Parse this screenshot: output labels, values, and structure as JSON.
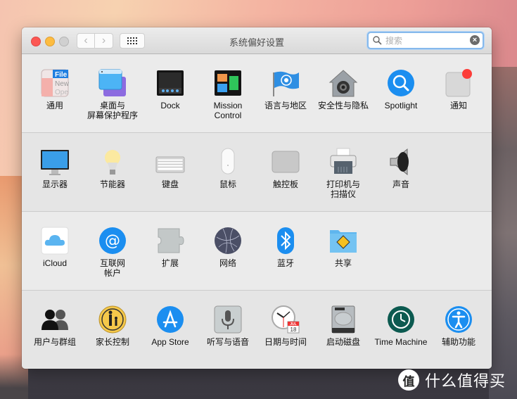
{
  "window": {
    "title": "系统偏好设置",
    "nav": {
      "back_icon": "‹",
      "forward_icon": "›"
    },
    "search": {
      "placeholder": "搜索",
      "value": "",
      "clear_icon": "×"
    }
  },
  "sections": [
    {
      "items": [
        {
          "label": "通用",
          "icon": "general-icon"
        },
        {
          "label": "桌面与\n屏幕保护程序",
          "icon": "desktop-screensaver-icon"
        },
        {
          "label": "Dock",
          "icon": "dock-icon"
        },
        {
          "label": "Mission\nControl",
          "icon": "mission-control-icon"
        },
        {
          "label": "语言与地区",
          "icon": "language-region-icon"
        },
        {
          "label": "安全性与隐私",
          "icon": "security-privacy-icon"
        },
        {
          "label": "Spotlight",
          "icon": "spotlight-icon"
        },
        {
          "label": "通知",
          "icon": "notifications-icon"
        }
      ]
    },
    {
      "items": [
        {
          "label": "显示器",
          "icon": "displays-icon"
        },
        {
          "label": "节能器",
          "icon": "energy-saver-icon"
        },
        {
          "label": "键盘",
          "icon": "keyboard-icon"
        },
        {
          "label": "鼠标",
          "icon": "mouse-icon"
        },
        {
          "label": "触控板",
          "icon": "trackpad-icon"
        },
        {
          "label": "打印机与\n扫描仪",
          "icon": "printers-scanners-icon"
        },
        {
          "label": "声音",
          "icon": "sound-icon"
        }
      ]
    },
    {
      "items": [
        {
          "label": "iCloud",
          "icon": "icloud-icon"
        },
        {
          "label": "互联网\n帐户",
          "icon": "internet-accounts-icon"
        },
        {
          "label": "扩展",
          "icon": "extensions-icon"
        },
        {
          "label": "网络",
          "icon": "network-icon"
        },
        {
          "label": "蓝牙",
          "icon": "bluetooth-icon"
        },
        {
          "label": "共享",
          "icon": "sharing-icon"
        }
      ]
    },
    {
      "items": [
        {
          "label": "用户与群组",
          "icon": "users-groups-icon"
        },
        {
          "label": "家长控制",
          "icon": "parental-controls-icon"
        },
        {
          "label": "App Store",
          "icon": "app-store-icon"
        },
        {
          "label": "听写与语音",
          "icon": "dictation-speech-icon"
        },
        {
          "label": "日期与时间",
          "icon": "date-time-icon"
        },
        {
          "label": "启动磁盘",
          "icon": "startup-disk-icon"
        },
        {
          "label": "Time Machine",
          "icon": "time-machine-icon"
        },
        {
          "label": "辅助功能",
          "icon": "accessibility-icon"
        }
      ]
    }
  ],
  "icon_text": {
    "general_file": "File",
    "general_new": "New",
    "general_open": "Ope",
    "calendar_month": "JUL",
    "calendar_day": "18"
  },
  "watermark": {
    "badge": "值",
    "text": "什么值得买"
  },
  "colors": {
    "close": "#fc5753",
    "minimize": "#fdbc40",
    "maximize": "#d0d0d0",
    "search_focus": "#86b9ec",
    "notification_badge": "#fc3d39"
  }
}
